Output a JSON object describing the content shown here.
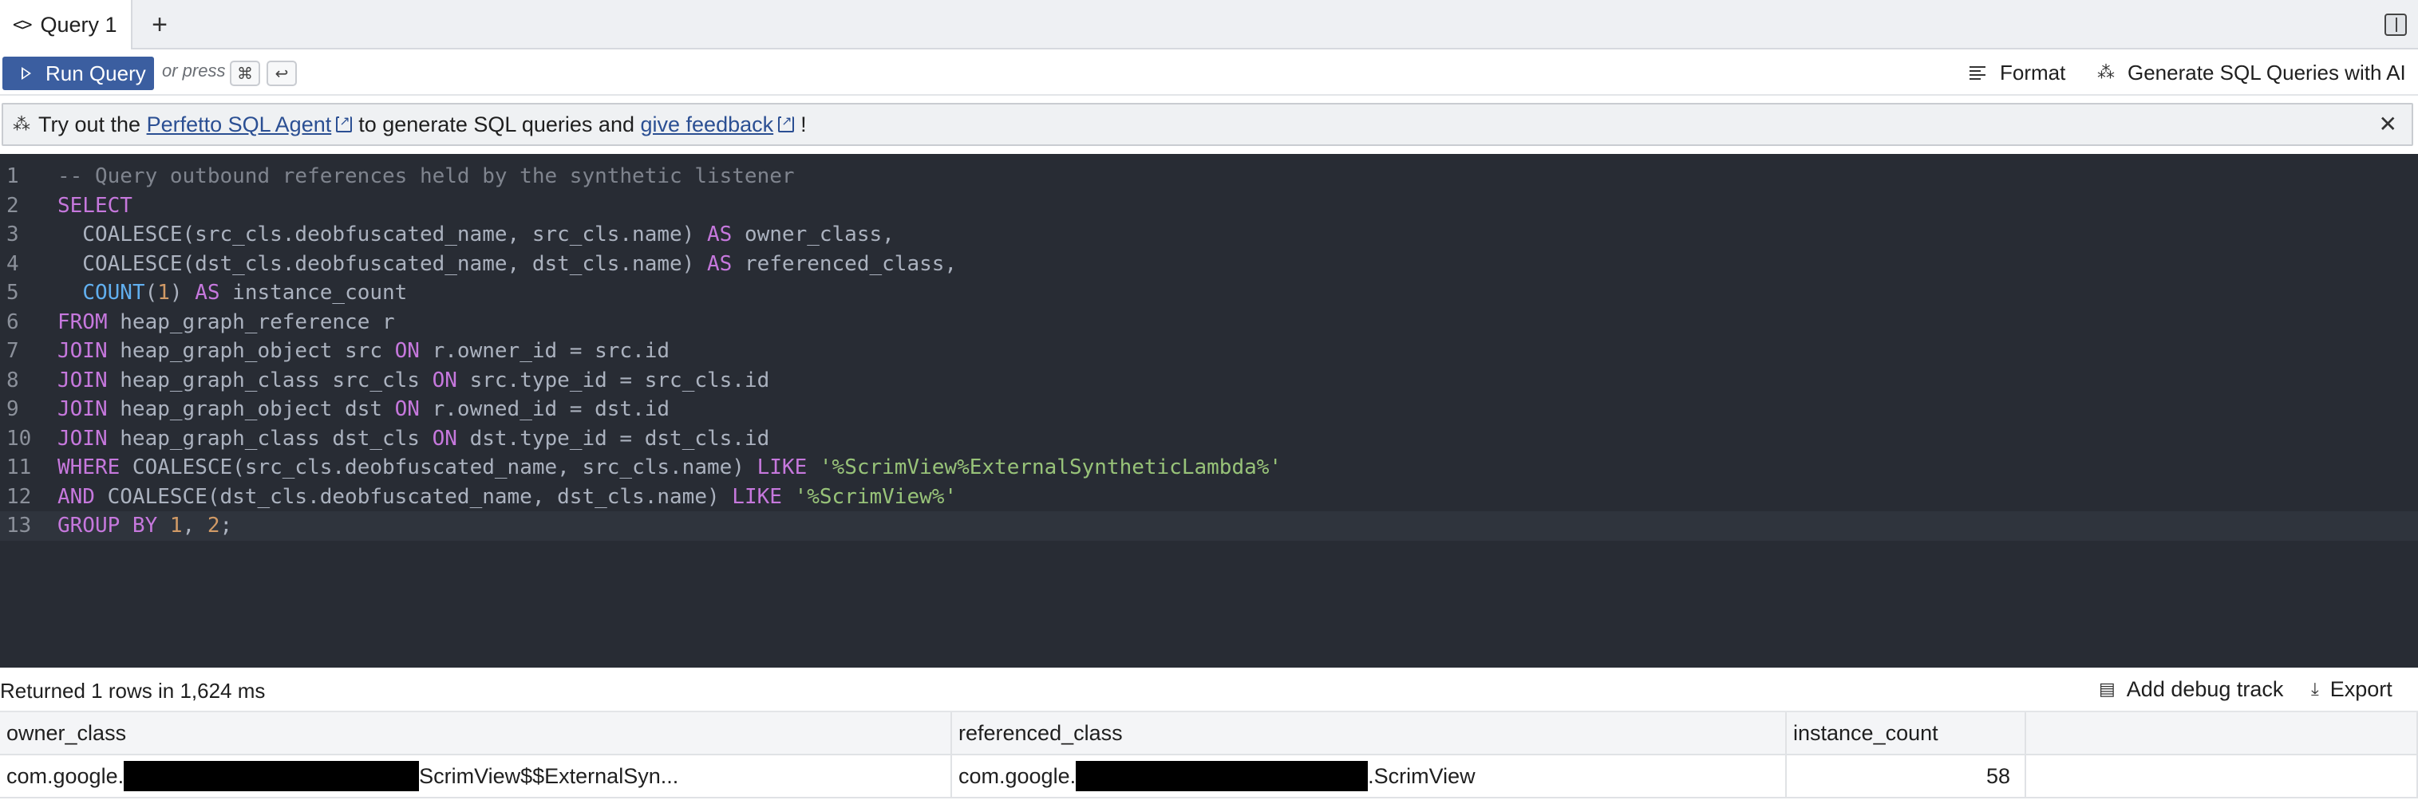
{
  "tabs": [
    {
      "label": "Query 1"
    }
  ],
  "toolbar": {
    "run_label": "Run Query",
    "or_press": "or press",
    "shortcut_keys": [
      "⌘",
      "↩"
    ],
    "format_label": "Format",
    "generate_label": "Generate SQL Queries with AI"
  },
  "banner": {
    "prefix": "Try out the",
    "agent_link": "Perfetto SQL Agent",
    "middle": "to generate SQL queries and",
    "feedback_link": "give feedback",
    "suffix": "!"
  },
  "editor": {
    "lines": [
      [
        {
          "t": "comment",
          "v": "-- Query outbound references held by the synthetic listener"
        }
      ],
      [
        {
          "t": "kw",
          "v": "SELECT"
        }
      ],
      [
        {
          "t": "plain",
          "v": "  COALESCE(src_cls.deobfuscated_name, src_cls.name) "
        },
        {
          "t": "kw",
          "v": "AS"
        },
        {
          "t": "plain",
          "v": " owner_class,"
        }
      ],
      [
        {
          "t": "plain",
          "v": "  COALESCE(dst_cls.deobfuscated_name, dst_cls.name) "
        },
        {
          "t": "kw",
          "v": "AS"
        },
        {
          "t": "plain",
          "v": " referenced_class,"
        }
      ],
      [
        {
          "t": "plain",
          "v": "  "
        },
        {
          "t": "fn",
          "v": "COUNT"
        },
        {
          "t": "plain",
          "v": "("
        },
        {
          "t": "num",
          "v": "1"
        },
        {
          "t": "plain",
          "v": ") "
        },
        {
          "t": "kw",
          "v": "AS"
        },
        {
          "t": "plain",
          "v": " instance_count"
        }
      ],
      [
        {
          "t": "kw",
          "v": "FROM"
        },
        {
          "t": "plain",
          "v": " heap_graph_reference r"
        }
      ],
      [
        {
          "t": "kw",
          "v": "JOIN"
        },
        {
          "t": "plain",
          "v": " heap_graph_object src "
        },
        {
          "t": "kw",
          "v": "ON"
        },
        {
          "t": "plain",
          "v": " r.owner_id = src.id"
        }
      ],
      [
        {
          "t": "kw",
          "v": "JOIN"
        },
        {
          "t": "plain",
          "v": " heap_graph_class src_cls "
        },
        {
          "t": "kw",
          "v": "ON"
        },
        {
          "t": "plain",
          "v": " src.type_id = src_cls.id"
        }
      ],
      [
        {
          "t": "kw",
          "v": "JOIN"
        },
        {
          "t": "plain",
          "v": " heap_graph_object dst "
        },
        {
          "t": "kw",
          "v": "ON"
        },
        {
          "t": "plain",
          "v": " r.owned_id = dst.id"
        }
      ],
      [
        {
          "t": "kw",
          "v": "JOIN"
        },
        {
          "t": "plain",
          "v": " heap_graph_class dst_cls "
        },
        {
          "t": "kw",
          "v": "ON"
        },
        {
          "t": "plain",
          "v": " dst.type_id = dst_cls.id"
        }
      ],
      [
        {
          "t": "kw",
          "v": "WHERE"
        },
        {
          "t": "plain",
          "v": " COALESCE(src_cls.deobfuscated_name, src_cls.name) "
        },
        {
          "t": "kw",
          "v": "LIKE"
        },
        {
          "t": "plain",
          "v": " "
        },
        {
          "t": "str",
          "v": "'%ScrimView%ExternalSyntheticLambda%'"
        }
      ],
      [
        {
          "t": "kw",
          "v": "AND"
        },
        {
          "t": "plain",
          "v": " COALESCE(dst_cls.deobfuscated_name, dst_cls.name) "
        },
        {
          "t": "kw",
          "v": "LIKE"
        },
        {
          "t": "plain",
          "v": " "
        },
        {
          "t": "str",
          "v": "'%ScrimView%'"
        }
      ],
      [
        {
          "t": "kw",
          "v": "GROUP BY"
        },
        {
          "t": "plain",
          "v": " "
        },
        {
          "t": "num",
          "v": "1"
        },
        {
          "t": "plain",
          "v": ", "
        },
        {
          "t": "num",
          "v": "2"
        },
        {
          "t": "plain",
          "v": ";"
        }
      ]
    ],
    "active_line": 13
  },
  "status": {
    "text": "Returned 1 rows in 1,624 ms",
    "debug_label": "Add debug track",
    "export_label": "Export"
  },
  "results": {
    "columns": [
      "owner_class",
      "referenced_class",
      "instance_count"
    ],
    "rows": [
      {
        "owner_prefix": "com.google.",
        "owner_suffix": "ScrimView$$ExternalSyn...",
        "ref_prefix": "com.google.",
        "ref_suffix": ".ScrimView",
        "count": "58"
      }
    ]
  },
  "colors": {
    "accent": "#3b5ea0",
    "editor_bg": "#282c34",
    "keyword": "#c678dd",
    "function": "#61afef",
    "number": "#d19a66",
    "string": "#98c379",
    "comment": "#7f848e"
  }
}
